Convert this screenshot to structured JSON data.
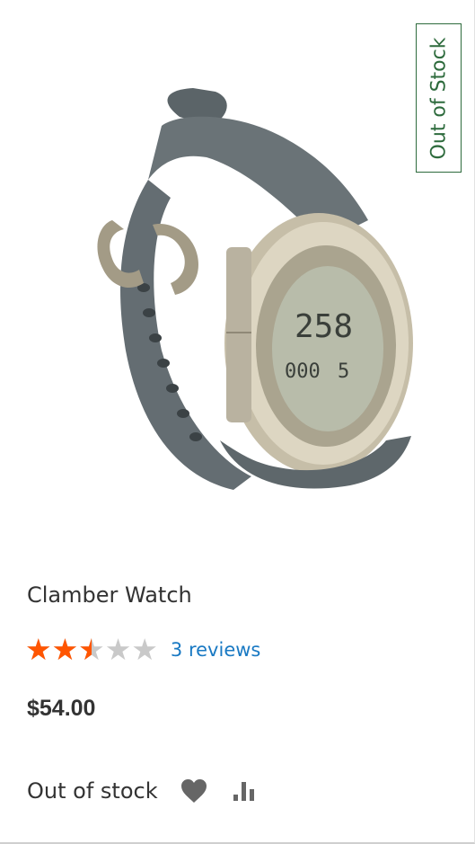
{
  "badge": {
    "label": "Out of Stock"
  },
  "product": {
    "name": "Clamber Watch",
    "rating_fraction": 0.5,
    "stars_glyphs": "★★★★★",
    "reviews_label": "3 reviews",
    "price": "$54.00",
    "stock_status": "Out of stock"
  },
  "icons": {
    "wishlist": "heart-icon",
    "compare": "bar-chart-icon"
  },
  "colors": {
    "star_active": "#ff5501",
    "star_inactive": "#c9c9c9",
    "link": "#1979c3",
    "badge": "#2e6b3d"
  }
}
